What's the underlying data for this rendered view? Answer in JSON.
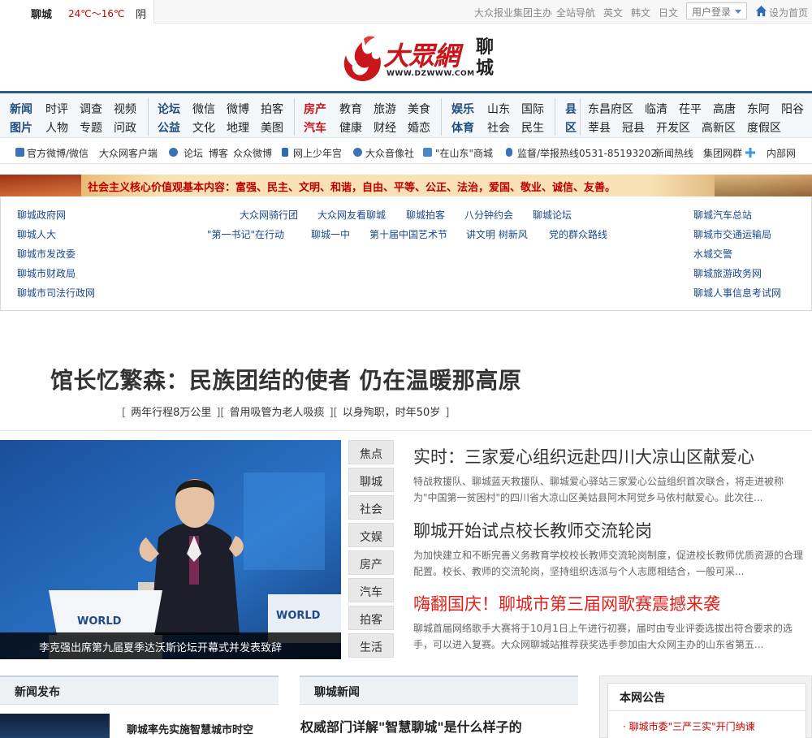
{
  "topbar": {
    "city": "聊城",
    "temp": "24℃～16℃",
    "condition": "阴",
    "links": [
      "大众报业集团主办",
      "全站导航",
      "英文",
      "韩文",
      "日文"
    ],
    "login": "用户登录",
    "set_home": "设为首页"
  },
  "logo": {
    "brand": "大眾網",
    "url": "WWW.DZWWW.COM",
    "city": "聊城"
  },
  "nav": {
    "news": [
      "新闻",
      "时评",
      "调查",
      "视频",
      "图片",
      "人物",
      "专题",
      "问政"
    ],
    "forum": [
      "论坛",
      "微信",
      "微博",
      "拍客",
      "公益",
      "文化",
      "地理",
      "美图"
    ],
    "house": [
      "房产",
      "教育",
      "旅游",
      "美食",
      "汽车",
      "健康",
      "财经",
      "婚恋"
    ],
    "ent": [
      "娱乐",
      "山东",
      "国际",
      "体育",
      "社会",
      "民生"
    ],
    "county_head": [
      "县",
      "区"
    ],
    "counties": [
      "东昌府区",
      "临清",
      "茌平",
      "高唐",
      "东阿",
      "阳谷",
      "莘县",
      "冠县",
      "开发区",
      "高新区",
      "度假区"
    ]
  },
  "services": [
    "官方微博/微信",
    "大众网客户端",
    "论坛",
    "博客",
    "众众微博",
    "网上少年宫",
    "大众音像社",
    "\"在山东\"商城",
    "监督/举报热线0531-85193202",
    "新闻热线",
    "集团网群",
    "内部网"
  ],
  "banner": "社会主义核心价值观基本内容：富强、民主、文明、和谐，自由、平等、公正、法治，爱国、敬业、诚信、友善。",
  "links": {
    "left": [
      "聊城政府网",
      "聊城人大",
      "聊城市发改委",
      "聊城市财政局",
      "聊城市司法行政网"
    ],
    "mid1": [
      "大众网骑行团",
      "大众网友看聊城",
      "聊城拍客",
      "八分钟约会",
      "聊城论坛"
    ],
    "mid2": [
      "\"第一书记\"在行动",
      "聊城一中",
      "第十届中国艺术节",
      "讲文明 树新风",
      "党的群众路线"
    ],
    "right": [
      "聊城汽车总站",
      "聊城市交通运输局",
      "水城交警",
      "聊城旅游政务网",
      "聊城人事信息考试网"
    ]
  },
  "headline": {
    "title": "馆长忆繁森：民族团结的使者 仍在温暖那高原",
    "subs": [
      "两年行程8万公里",
      "曾用吸管为老人吸痰",
      "以身殉职，时年50岁"
    ]
  },
  "focus": {
    "caption": "李克强出席第九届夏季达沃斯论坛开幕式并发表致辞",
    "tabs": [
      "焦点",
      "聊城",
      "社会",
      "文娱",
      "房产",
      "汽车",
      "拍客",
      "生活"
    ],
    "stories": [
      {
        "title": "实时：三家爱心组织远赴四川大凉山区献爱心",
        "desc": "特战救援队、聊城蓝天救援队、聊城爱心驿站三家爱心公益组织首次联合，将走进被称为\"中国第一贫困村\"的四川省大凉山区美姑县阿木阿觉乡马依村献爱心。此次往..."
      },
      {
        "title": "聊城开始试点校长教师交流轮岗",
        "desc": "为加快建立和不断完善义务教育学校校长教师交流轮岗制度，促进校长教师优质资源的合理配置。校长、教师的交流轮岗，坚持组织选派与个人志愿相结合，一般可采..."
      },
      {
        "title": "嗨翻国庆！聊城市第三届网歌赛震撼来袭",
        "desc": "聊城首届网络歌手大赛将于10月1日上午进行初赛，届时由专业评委选拔出符合要求的选手，可以进入复赛。大众网聊城站推荐获奖选手参加由大众网主办的山东省第五..."
      }
    ]
  },
  "sections": {
    "release": "新闻发布",
    "lcnews": "聊城新闻",
    "notice": "本网公告",
    "notice_item": "聊城市委\"三严三实\"开门纳谏",
    "release_item": "聊城率先实施智慧城市时空",
    "lcnews_item": "权威部门详解\"智慧聊城\"是什么样子的"
  }
}
